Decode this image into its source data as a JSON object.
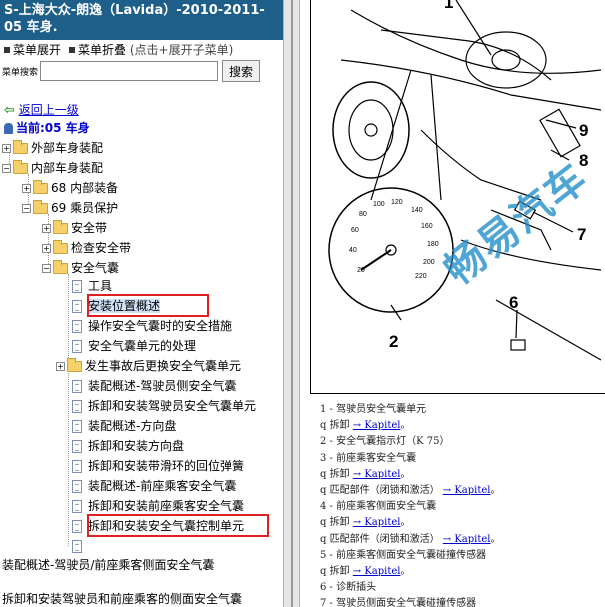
{
  "title": "S-上海大众-朗逸（Lavida）-2010-2011- 05 车身.",
  "toolbar": {
    "expand_label": "菜单展开",
    "collapse_label": "菜单折叠",
    "collapse_hint": "(点击+展开子菜单)"
  },
  "search": {
    "label": "菜单搜索",
    "value": "",
    "button_label": "搜索"
  },
  "nav": {
    "back_label": "返回上一级",
    "current_label": "当前:05 车身"
  },
  "tree": {
    "outer_body": "外部车身装配",
    "inner_body": "内部车身装配",
    "g68": "68 内部装备",
    "g69": "69 乘员保护",
    "seatbelt": "安全带",
    "check_safety": "检查安全带",
    "airbag": "安全气囊",
    "items": [
      "工具",
      "安装位置概述",
      "操作安全气囊时的安全措施",
      "安全气囊单元的处理",
      "发生事故后更换安全气囊单元",
      "装配概述-驾驶员侧安全气囊",
      "拆卸和安装驾驶员安全气囊单元",
      "装配概述-方向盘",
      "拆卸和安装方向盘",
      "拆卸和安装带滑环的回位弹簧",
      "装配概述-前座乘客安全气囊",
      "拆卸和安装前座乘客安全气囊",
      "拆卸和安装安全气囊控制单元",
      ""
    ],
    "tail_1": "装配概述-驾驶员/前座乘客侧面安全气囊",
    "tail_2": "拆卸和安装驾驶员和前座乘客的侧面安全气囊"
  },
  "diagram": {
    "callouts": [
      "1",
      "2",
      "6",
      "7",
      "8",
      "9"
    ],
    "speedo_ticks": [
      "20",
      "40",
      "60",
      "80",
      "100",
      "120",
      "140",
      "160",
      "180",
      "200",
      "220"
    ],
    "watermark": "畅易汽车"
  },
  "legend": [
    {
      "text": "1 - 驾驶员安全气囊单元",
      "link": ""
    },
    {
      "text": "q  拆卸",
      "link": "→ Kapitel",
      "suffix": "。"
    },
    {
      "text": "2 - 安全气囊指示灯（K 75）",
      "link": ""
    },
    {
      "text": "3 - 前座乘客安全气囊",
      "link": ""
    },
    {
      "text": "q  拆卸",
      "link": "→ Kapitel",
      "suffix": "。"
    },
    {
      "text": "q  匹配部件（闭锁和激活）",
      "link": "→ Kapitel",
      "suffix": "。"
    },
    {
      "text": "4 - 前座乘客侧面安全气囊",
      "link": ""
    },
    {
      "text": "q  拆卸",
      "link": "→ Kapitel",
      "suffix": "。"
    },
    {
      "text": "q  匹配部件（闭锁和激活）",
      "link": "→ Kapitel",
      "suffix": "。"
    },
    {
      "text": "5 - 前座乘客侧面安全气囊碰撞传感器",
      "link": ""
    },
    {
      "text": "q  拆卸",
      "link": "→ Kapitel",
      "suffix": "。"
    },
    {
      "text": "6 - 诊断插头",
      "link": ""
    },
    {
      "text": "7 - 驾驶员侧面安全气囊碰撞传感器",
      "link": ""
    }
  ],
  "colors": {
    "title_bg": "#1e5f8a",
    "highlight": "#e02020",
    "link": "#0000cc",
    "watermark": "#1e8cc8"
  }
}
